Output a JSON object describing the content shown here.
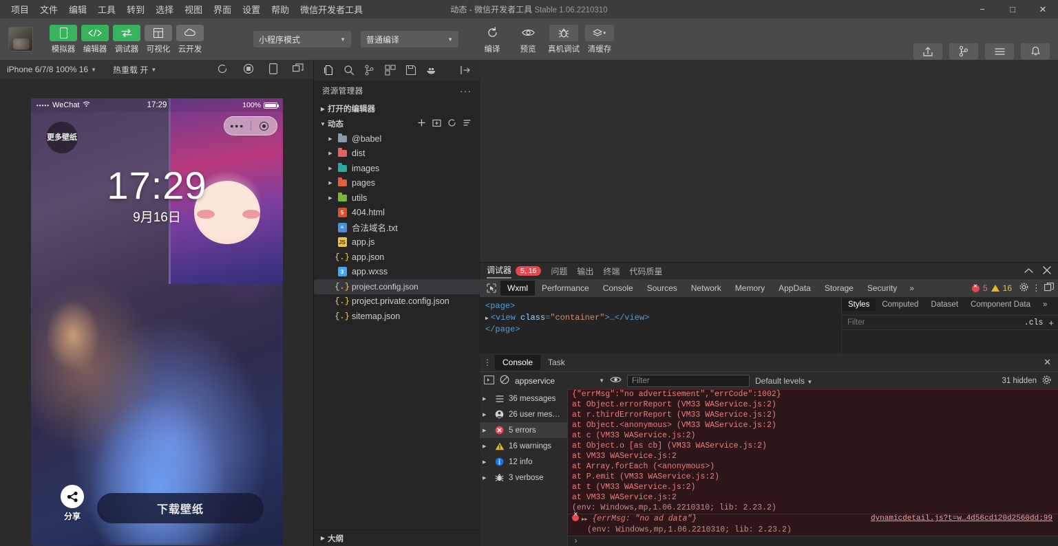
{
  "window": {
    "title_main": "动态",
    "title_sep": " - ",
    "title_app": "微信开发者工具",
    "title_version": "Stable 1.06.2210310",
    "minimize": "−",
    "maximize": "□",
    "close": "✕"
  },
  "menubar": {
    "items": [
      "项目",
      "文件",
      "编辑",
      "工具",
      "转到",
      "选择",
      "视图",
      "界面",
      "设置",
      "帮助",
      "微信开发者工具"
    ]
  },
  "toolbar": {
    "panel_buttons": [
      {
        "label": "模拟器",
        "active": true,
        "icon": "phone-icon"
      },
      {
        "label": "编辑器",
        "active": true,
        "icon": "code-icon"
      },
      {
        "label": "调试器",
        "active": true,
        "icon": "debug-swap-icon"
      },
      {
        "label": "可视化",
        "active": false,
        "icon": "layout-icon"
      },
      {
        "label": "云开发",
        "active": false,
        "icon": "cloud-icon"
      }
    ],
    "mode_select": "小程序模式",
    "compile_select": "普通编译",
    "actions": [
      {
        "label": "编译",
        "icon": "refresh-icon"
      },
      {
        "label": "预览",
        "icon": "eye-icon"
      },
      {
        "label": "真机调试",
        "icon": "bug-icon"
      },
      {
        "label": "清缓存",
        "icon": "layers-icon",
        "caret": true
      }
    ],
    "right_actions": [
      {
        "label": "上传",
        "icon": "upload-icon"
      },
      {
        "label": "版本管理",
        "icon": "git-branch-icon"
      },
      {
        "label": "详情",
        "icon": "menu-lines-icon"
      },
      {
        "label": "消息",
        "icon": "bell-icon"
      }
    ]
  },
  "simulator": {
    "device_select": "iPhone 6/7/8 100% 16",
    "hot_reload": "热重载 开",
    "icons": [
      "refresh-icon",
      "record-icon",
      "rotate-device-icon",
      "detach-window-icon"
    ],
    "phone": {
      "carrier": "WeChat",
      "signal_dots": "•••••",
      "wifi": "wifi-icon",
      "time": "17:29",
      "battery_pct": "100%",
      "stamp_line1": "更多",
      "stamp_line2": "壁纸",
      "clock": "17:29",
      "date": "9月16日",
      "share_label": "分享",
      "download_label": "下载壁纸",
      "capsule_dots": "•••"
    }
  },
  "explorer": {
    "activity_icons": [
      "files-icon",
      "search-icon",
      "source-control-icon",
      "extensions-icon",
      "save-icon",
      "docker-icon",
      "collapse-panel-icon"
    ],
    "title": "资源管理器",
    "more": "···",
    "open_editors": "打开的编辑器",
    "project_name": "动态",
    "project_actions": [
      "new-file-icon",
      "new-folder-icon",
      "refresh-icon",
      "collapse-all-icon"
    ],
    "outline": "大纲",
    "tree": [
      {
        "name": "@babel",
        "type": "folder",
        "color": "#8a9aa8",
        "expandable": true
      },
      {
        "name": "dist",
        "type": "folder",
        "color": "#e36363",
        "expandable": true
      },
      {
        "name": "images",
        "type": "folder",
        "color": "#2fa8a0",
        "expandable": true
      },
      {
        "name": "pages",
        "type": "folder",
        "color": "#e0603c",
        "expandable": true
      },
      {
        "name": "utils",
        "type": "folder",
        "color": "#7ab83c",
        "expandable": true
      },
      {
        "name": "404.html",
        "type": "html",
        "color": "#e34c26",
        "expandable": false
      },
      {
        "name": "合法域名.txt",
        "type": "txt",
        "color": "#4a90d9",
        "expandable": false
      },
      {
        "name": "app.js",
        "type": "js",
        "color": "#e8c547",
        "expandable": false
      },
      {
        "name": "app.json",
        "type": "json",
        "color": "#f0d264",
        "expandable": false
      },
      {
        "name": "app.wxss",
        "type": "css",
        "color": "#42a5f5",
        "expandable": false
      },
      {
        "name": "project.config.json",
        "type": "json",
        "color": "#f0d264",
        "expandable": false,
        "selected": true
      },
      {
        "name": "project.private.config.json",
        "type": "json",
        "color": "#f0d264",
        "expandable": false
      },
      {
        "name": "sitemap.json",
        "type": "json",
        "color": "#f0d264",
        "expandable": false
      }
    ]
  },
  "devtools": {
    "panel_tabs": [
      {
        "label": "调试器",
        "active": true,
        "badge": "5, 16"
      },
      {
        "label": "问题",
        "active": false
      },
      {
        "label": "输出",
        "active": false
      },
      {
        "label": "终端",
        "active": false
      },
      {
        "label": "代码质量",
        "active": false
      }
    ],
    "collapse_icon": "chevron-up-icon",
    "close_icon": "close-icon",
    "dev_tabs": [
      {
        "label": "Wxml",
        "active": true
      },
      {
        "label": "Performance",
        "active": false
      },
      {
        "label": "Console",
        "active": false
      },
      {
        "label": "Sources",
        "active": false
      },
      {
        "label": "Network",
        "active": false
      },
      {
        "label": "Memory",
        "active": false
      },
      {
        "label": "AppData",
        "active": false
      },
      {
        "label": "Storage",
        "active": false
      },
      {
        "label": "Security",
        "active": false
      }
    ],
    "dev_tabs_more": "»",
    "error_count": "5",
    "warning_count": "16",
    "wxml": {
      "line1": "<page>",
      "line2_tag_open": "<view",
      "line2_attr": "class",
      "line2_val": "\"container\"",
      "line2_tail": ">…</view>",
      "line3": "</page>"
    },
    "styles": {
      "tabs": [
        {
          "label": "Styles",
          "active": true
        },
        {
          "label": "Computed",
          "active": false
        },
        {
          "label": "Dataset",
          "active": false
        },
        {
          "label": "Component Data",
          "active": false
        }
      ],
      "more": "»",
      "filter_placeholder": "Filter",
      "cls": ".cls",
      "plus": "+"
    },
    "console": {
      "tabs": [
        {
          "label": "Console",
          "active": true
        },
        {
          "label": "Task",
          "active": false
        }
      ],
      "context": "appservice",
      "filter_placeholder": "Filter",
      "levels": "Default levels",
      "hidden": "31 hidden",
      "sidebar": [
        {
          "label": "36 messages",
          "icon": "list-icon",
          "active": false
        },
        {
          "label": "26 user mes…",
          "icon": "user-icon",
          "active": false
        },
        {
          "label": "5 errors",
          "icon": "error-icon",
          "active": true
        },
        {
          "label": "16 warnings",
          "icon": "warning-icon",
          "active": false
        },
        {
          "label": "12 info",
          "icon": "info-icon",
          "active": false
        },
        {
          "label": "3 verbose",
          "icon": "verbose-icon",
          "active": false
        }
      ],
      "error_block_lines": [
        "{\"errMsg\":\"no advertisement\",\"errCode\":1002}",
        "    at Object.errorReport (VM33 WAService.js:2)",
        "    at r.thirdErrorReport (VM33 WAService.js:2)",
        "    at Object.<anonymous> (VM33 WAService.js:2)",
        "    at c (VM33 WAService.js:2)",
        "    at Object.o [as cb] (VM33 WAService.js:2)",
        "    at VM33 WAService.js:2",
        "    at Array.forEach (<anonymous>)",
        "    at P.emit (VM33 WAService.js:2)",
        "    at t (VM33 WAService.js:2)",
        "    at VM33 WAService.js:2"
      ],
      "env_line": "(env: Windows,mp,1.06.2210310; lib: 2.23.2)",
      "error2_text": "{errMsg: \"no ad data\"}",
      "error2_source": "dynamicdetail.js?t=w…4d56cd120d2560dd:99",
      "error2_env": "(env: Windows,mp,1.06.2210310; lib: 2.23.2)",
      "prompt": "›"
    }
  },
  "colors": {
    "accent_green": "#36b35c",
    "error_red": "#e5484d",
    "warning_yellow": "#e5b82a",
    "titlebar_bg": "#3c3c3c",
    "toolbar_bg": "#4a4a4a",
    "editor_bg": "#2f2f2f",
    "sidebar_bg": "#252526"
  }
}
